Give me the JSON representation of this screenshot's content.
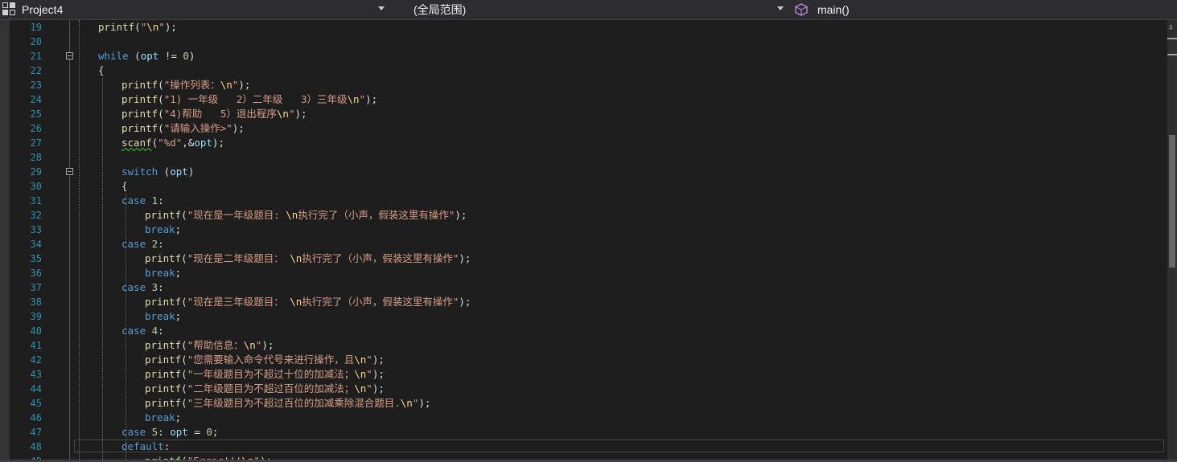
{
  "toolbar": {
    "project_name": "Project4",
    "scope": "(全局范围)",
    "member": "main()",
    "project_icon": "project-icon",
    "member_icon": "cube-icon"
  },
  "editor": {
    "lines": [
      {
        "n": "19",
        "indent": 1,
        "tokens": [
          [
            "fn",
            "printf"
          ],
          [
            "p",
            "("
          ],
          [
            "str",
            "\""
          ],
          [
            "esc",
            "\\n"
          ],
          [
            "str",
            "\""
          ],
          [
            "p",
            ");"
          ]
        ]
      },
      {
        "n": "20",
        "indent": 0,
        "tokens": []
      },
      {
        "n": "21",
        "indent": 1,
        "fold": true,
        "tokens": [
          [
            "kw",
            "while"
          ],
          [
            "p",
            " ("
          ],
          [
            "id",
            "opt"
          ],
          [
            "p",
            " != "
          ],
          [
            "num",
            "0"
          ],
          [
            "p",
            ")"
          ]
        ]
      },
      {
        "n": "22",
        "indent": 1,
        "tokens": [
          [
            "p",
            "{"
          ]
        ]
      },
      {
        "n": "23",
        "indent": 2,
        "tokens": [
          [
            "fn",
            "printf"
          ],
          [
            "p",
            "("
          ],
          [
            "str",
            "\"操作列表："
          ],
          [
            "esc",
            "\\n"
          ],
          [
            "str",
            "\""
          ],
          [
            "p",
            ");"
          ]
        ]
      },
      {
        "n": "24",
        "indent": 2,
        "tokens": [
          [
            "fn",
            "printf"
          ],
          [
            "p",
            "("
          ],
          [
            "str",
            "\"1) 一年级   2）二年级   3）三年级"
          ],
          [
            "esc",
            "\\n"
          ],
          [
            "str",
            "\""
          ],
          [
            "p",
            ");"
          ]
        ]
      },
      {
        "n": "25",
        "indent": 2,
        "tokens": [
          [
            "fn",
            "printf"
          ],
          [
            "p",
            "("
          ],
          [
            "str",
            "\"4)帮助   5）退出程序"
          ],
          [
            "esc",
            "\\n"
          ],
          [
            "str",
            "\""
          ],
          [
            "p",
            ");"
          ]
        ]
      },
      {
        "n": "26",
        "indent": 2,
        "tokens": [
          [
            "fn",
            "printf"
          ],
          [
            "p",
            "("
          ],
          [
            "str",
            "\"请输入操作>\""
          ],
          [
            "p",
            ");"
          ]
        ]
      },
      {
        "n": "27",
        "indent": 2,
        "tokens": [
          [
            "fnsq",
            "scanf"
          ],
          [
            "p",
            "("
          ],
          [
            "str",
            "\"%d\""
          ],
          [
            "p",
            ",&"
          ],
          [
            "id",
            "opt"
          ],
          [
            "p",
            ");"
          ]
        ]
      },
      {
        "n": "28",
        "indent": 0,
        "tokens": []
      },
      {
        "n": "29",
        "indent": 2,
        "fold": true,
        "tokens": [
          [
            "kw",
            "switch"
          ],
          [
            "p",
            " ("
          ],
          [
            "id",
            "opt"
          ],
          [
            "p",
            ")"
          ]
        ]
      },
      {
        "n": "30",
        "indent": 2,
        "tokens": [
          [
            "p",
            "{"
          ]
        ]
      },
      {
        "n": "31",
        "indent": 2,
        "tokens": [
          [
            "kw",
            "case"
          ],
          [
            "p",
            " "
          ],
          [
            "num",
            "1"
          ],
          [
            "p",
            ":"
          ]
        ]
      },
      {
        "n": "32",
        "indent": 3,
        "tokens": [
          [
            "fn",
            "printf"
          ],
          [
            "p",
            "("
          ],
          [
            "str",
            "\"现在是一年级题目: "
          ],
          [
            "esc",
            "\\n"
          ],
          [
            "str",
            "执行完了（小声，假装这里有操作\""
          ],
          [
            "p",
            ");"
          ]
        ]
      },
      {
        "n": "33",
        "indent": 3,
        "tokens": [
          [
            "kw",
            "break"
          ],
          [
            "p",
            ";"
          ]
        ]
      },
      {
        "n": "34",
        "indent": 2,
        "tokens": [
          [
            "kw",
            "case"
          ],
          [
            "p",
            " "
          ],
          [
            "num",
            "2"
          ],
          [
            "p",
            ":"
          ]
        ]
      },
      {
        "n": "35",
        "indent": 3,
        "tokens": [
          [
            "fn",
            "printf"
          ],
          [
            "p",
            "("
          ],
          [
            "str",
            "\"现在是二年级题目： "
          ],
          [
            "esc",
            "\\n"
          ],
          [
            "str",
            "执行完了（小声，假装这里有操作\""
          ],
          [
            "p",
            ");"
          ]
        ]
      },
      {
        "n": "36",
        "indent": 3,
        "tokens": [
          [
            "kw",
            "break"
          ],
          [
            "p",
            ";"
          ]
        ]
      },
      {
        "n": "37",
        "indent": 2,
        "tokens": [
          [
            "kw",
            "case"
          ],
          [
            "p",
            " "
          ],
          [
            "num",
            "3"
          ],
          [
            "p",
            ":"
          ]
        ]
      },
      {
        "n": "38",
        "indent": 3,
        "tokens": [
          [
            "fn",
            "printf"
          ],
          [
            "p",
            "("
          ],
          [
            "str",
            "\"现在是三年级题目： "
          ],
          [
            "esc",
            "\\n"
          ],
          [
            "str",
            "执行完了（小声，假装这里有操作\""
          ],
          [
            "p",
            ");"
          ]
        ]
      },
      {
        "n": "39",
        "indent": 3,
        "tokens": [
          [
            "kw",
            "break"
          ],
          [
            "p",
            ";"
          ]
        ]
      },
      {
        "n": "40",
        "indent": 2,
        "tokens": [
          [
            "kw",
            "case"
          ],
          [
            "p",
            " "
          ],
          [
            "num",
            "4"
          ],
          [
            "p",
            ":"
          ]
        ]
      },
      {
        "n": "41",
        "indent": 3,
        "tokens": [
          [
            "fn",
            "printf"
          ],
          [
            "p",
            "("
          ],
          [
            "str",
            "\"帮助信息："
          ],
          [
            "esc",
            "\\n"
          ],
          [
            "str",
            "\""
          ],
          [
            "p",
            ");"
          ]
        ]
      },
      {
        "n": "42",
        "indent": 3,
        "tokens": [
          [
            "fn",
            "printf"
          ],
          [
            "p",
            "("
          ],
          [
            "str",
            "\"您需要输入命令代号来进行操作，且"
          ],
          [
            "esc",
            "\\n"
          ],
          [
            "str",
            "\""
          ],
          [
            "p",
            ");"
          ]
        ]
      },
      {
        "n": "43",
        "indent": 3,
        "tokens": [
          [
            "fn",
            "printf"
          ],
          [
            "p",
            "("
          ],
          [
            "str",
            "\"一年级题目为不超过十位的加减法；"
          ],
          [
            "esc",
            "\\n"
          ],
          [
            "str",
            "\""
          ],
          [
            "p",
            ");"
          ]
        ]
      },
      {
        "n": "44",
        "indent": 3,
        "tokens": [
          [
            "fn",
            "printf"
          ],
          [
            "p",
            "("
          ],
          [
            "str",
            "\"二年级题目为不超过百位的加减法；"
          ],
          [
            "esc",
            "\\n"
          ],
          [
            "str",
            "\""
          ],
          [
            "p",
            ");"
          ]
        ]
      },
      {
        "n": "45",
        "indent": 3,
        "tokens": [
          [
            "fn",
            "printf"
          ],
          [
            "p",
            "("
          ],
          [
            "str",
            "\"三年级题目为不超过百位的加减乘除混合题目."
          ],
          [
            "esc",
            "\\n"
          ],
          [
            "str",
            "\""
          ],
          [
            "p",
            ");"
          ]
        ]
      },
      {
        "n": "46",
        "indent": 3,
        "tokens": [
          [
            "kw",
            "break"
          ],
          [
            "p",
            ";"
          ]
        ]
      },
      {
        "n": "47",
        "indent": 2,
        "tokens": [
          [
            "kw",
            "case"
          ],
          [
            "p",
            " "
          ],
          [
            "num",
            "5"
          ],
          [
            "p",
            ": "
          ],
          [
            "id",
            "opt"
          ],
          [
            "p",
            " = "
          ],
          [
            "num",
            "0"
          ],
          [
            "p",
            ";"
          ]
        ]
      },
      {
        "n": "48",
        "indent": 2,
        "current": true,
        "tokens": [
          [
            "kw",
            "default"
          ],
          [
            "p",
            ":"
          ]
        ]
      },
      {
        "n": "49",
        "indent": 3,
        "tokens": [
          [
            "fn",
            "printf"
          ],
          [
            "p",
            "("
          ],
          [
            "str",
            "\"Error!!!"
          ],
          [
            "esc",
            "\\n"
          ],
          [
            "str",
            "\""
          ],
          [
            "p",
            ");"
          ]
        ]
      }
    ]
  },
  "scrollbar": {
    "split_icon": "split-icon"
  }
}
